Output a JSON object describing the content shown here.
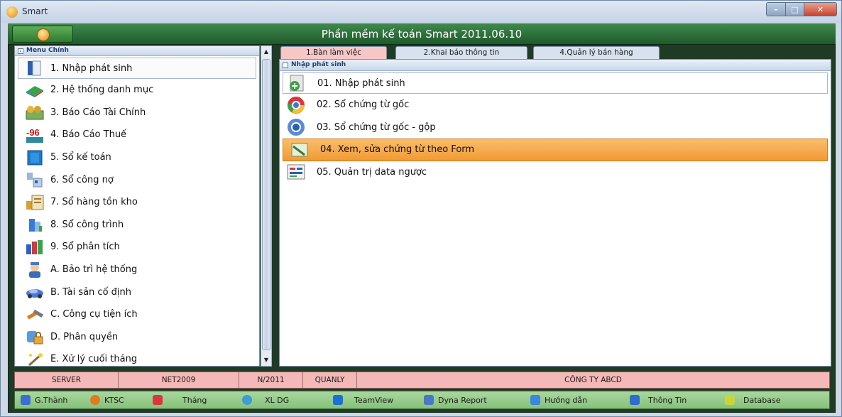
{
  "window": {
    "title": "Smart",
    "app_title": "Phần mềm kế toán Smart 2011.06.10"
  },
  "left_panel": {
    "header": "Menu Chính",
    "items": [
      {
        "label": "1. Nhập phát sinh",
        "icon": "document-icon"
      },
      {
        "label": "2. Hệ thống danh mục",
        "icon": "catalog-icon"
      },
      {
        "label": "3. Báo Cáo Tài Chính",
        "icon": "money-icon"
      },
      {
        "label": "4. Báo Cáo Thuế",
        "icon": "tax-icon"
      },
      {
        "label": "5. Sổ kế toán",
        "icon": "ledger-icon"
      },
      {
        "label": "6. Sổ công nợ",
        "icon": "debt-icon"
      },
      {
        "label": "7. Sổ hàng tồn kho",
        "icon": "inventory-icon"
      },
      {
        "label": "8. Sổ công trình",
        "icon": "building-icon"
      },
      {
        "label": "9. Sổ phân tích",
        "icon": "analysis-icon"
      },
      {
        "label": "A. Bảo trì hệ thống",
        "icon": "user-maintenance-icon"
      },
      {
        "label": "B. Tài sản cố định",
        "icon": "car-icon"
      },
      {
        "label": "C. Công cụ tiện ích",
        "icon": "tools-icon"
      },
      {
        "label": "D. Phân quyền",
        "icon": "permission-icon"
      },
      {
        "label": "E. Xử lý cuối tháng",
        "icon": "magic-icon"
      }
    ]
  },
  "tabs": [
    {
      "label": "1.Bàn làm việc"
    },
    {
      "label": "2.Khai báo thông tin"
    },
    {
      "label": "4.Quản lý bán hàng"
    }
  ],
  "right_panel": {
    "header": "Nhập phát sinh",
    "items": [
      {
        "label": "01. Nhập phát sinh",
        "icon": "add-document-icon"
      },
      {
        "label": "02. Sổ chứng từ gốc",
        "icon": "chrome-icon"
      },
      {
        "label": "03. Sổ chứng từ gốc - gộp",
        "icon": "chrome-blue-icon"
      },
      {
        "label": "04. Xem, sửa chứng từ  theo Form",
        "icon": "edit-form-icon"
      },
      {
        "label": "05. Quản trị data ngược",
        "icon": "data-admin-icon"
      }
    ]
  },
  "status_bar": {
    "server": "SERVER",
    "db": "NET2009",
    "period": "N/2011",
    "user": "QUANLY",
    "company": "CÔNG TY ABCD"
  },
  "toolbar": [
    {
      "label": "G.Thành",
      "icon": "pipe-icon",
      "color": "#3a6fd1"
    },
    {
      "label": "KTSC",
      "icon": "shield-icon",
      "color": "#e07a1f"
    },
    {
      "label": "Tháng",
      "icon": "calendar-icon",
      "color": "#d9363e"
    },
    {
      "label": "XL DG",
      "icon": "globe-icon",
      "color": "#3e9bd6"
    },
    {
      "label": "TeamView",
      "icon": "teamviewer-icon",
      "color": "#1d6fd6"
    },
    {
      "label": "Dyna Report",
      "icon": "report-icon",
      "color": "#4a78c4"
    },
    {
      "label": "Hướng dẫn",
      "icon": "help-icon",
      "color": "#3d86d9"
    },
    {
      "label": "Thông Tin",
      "icon": "info-icon",
      "color": "#2f6bd0"
    },
    {
      "label": "Database",
      "icon": "database-icon",
      "color": "#c9d63a"
    }
  ]
}
